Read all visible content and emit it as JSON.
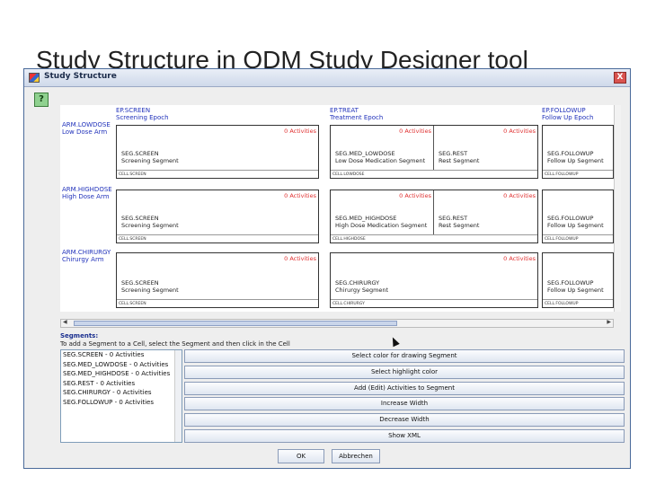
{
  "slide": {
    "title": "Study Structure in ODM Study Designer tool"
  },
  "window": {
    "title": "Study Structure",
    "close_label": "X",
    "help_label": "?"
  },
  "epochs": [
    {
      "id": "EP.SCREEN",
      "name": "Screening Epoch"
    },
    {
      "id": "EP.TREAT",
      "name": "Treatment Epoch"
    },
    {
      "id": "EP.FOLLOWUP",
      "name": "Follow Up Epoch"
    }
  ],
  "arms": [
    {
      "id": "ARM.LOWDOSE",
      "name": "Low Dose Arm"
    },
    {
      "id": "ARM.HIGHDOSE",
      "name": "High Dose Arm"
    },
    {
      "id": "ARM.CHIRURGY",
      "name": "Chirurgy Arm"
    }
  ],
  "cells": [
    [
      {
        "cell_id": "CELL.SCREEN",
        "segments": [
          {
            "activities": "0 Activities",
            "id": "SEG.SCREEN",
            "name": "Screening Segment"
          }
        ]
      },
      {
        "cell_id": "CELL.LOWDOSE",
        "segments": [
          {
            "activities": "0 Activities",
            "id": "SEG.MED_LOWDOSE",
            "name": "Low Dose Medication Segment"
          },
          {
            "activities": "0 Activities",
            "id": "SEG.REST",
            "name": "Rest Segment"
          }
        ]
      },
      {
        "cell_id": "CELL.FOLLOWUP",
        "segments": [
          {
            "activities": "",
            "id": "SEG.FOLLOWUP",
            "name": "Follow Up Segment"
          }
        ]
      }
    ],
    [
      {
        "cell_id": "CELL.SCREEN",
        "segments": [
          {
            "activities": "0 Activities",
            "id": "SEG.SCREEN",
            "name": "Screening Segment"
          }
        ]
      },
      {
        "cell_id": "CELL.HIGHDOSE",
        "segments": [
          {
            "activities": "0 Activities",
            "id": "SEG.MED_HIGHDOSE",
            "name": "High Dose Medication Segment"
          },
          {
            "activities": "0 Activities",
            "id": "SEG.REST",
            "name": "Rest Segment"
          }
        ]
      },
      {
        "cell_id": "CELL.FOLLOWUP",
        "segments": [
          {
            "activities": "",
            "id": "SEG.FOLLOWUP",
            "name": "Follow Up Segment"
          }
        ]
      }
    ],
    [
      {
        "cell_id": "CELL.SCREEN",
        "segments": [
          {
            "activities": "0 Activities",
            "id": "SEG.SCREEN",
            "name": "Screening Segment"
          }
        ]
      },
      {
        "cell_id": "CELL.CHIRURGY",
        "segments": [
          {
            "activities": "0 Activities",
            "id": "SEG.CHIRURGY",
            "name": "Chirurgy Segment"
          }
        ]
      },
      {
        "cell_id": "CELL.FOLLOWUP",
        "segments": [
          {
            "activities": "",
            "id": "SEG.FOLLOWUP",
            "name": "Follow Up Segment"
          }
        ]
      }
    ]
  ],
  "segments_panel": {
    "heading": "Segments:",
    "instruction": "To add a Segment to a Cell, select the Segment and then click in the Cell",
    "items": [
      "SEG.SCREEN - 0 Activities",
      "SEG.MED_LOWDOSE - 0 Activities",
      "SEG.MED_HIGHDOSE - 0 Activities",
      "SEG.REST - 0 Activities",
      "SEG.CHIRURGY - 0 Activities",
      "SEG.FOLLOWUP - 0 Activities"
    ]
  },
  "buttons": [
    "Select color for drawing Segment",
    "Select highlight color",
    "Add (Edit) Activities to Segment",
    "Increase Width",
    "Decrease Width",
    "Show XML"
  ],
  "footer": {
    "ok_label": "OK",
    "cancel_label": "Abbrechen"
  }
}
